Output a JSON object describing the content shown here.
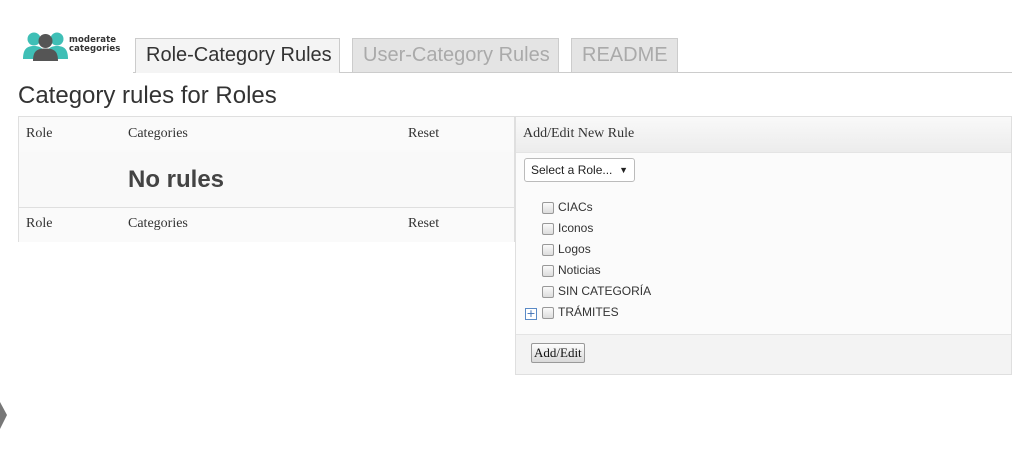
{
  "logo": {
    "line1": "moderate",
    "line2": "categories"
  },
  "tabs": [
    {
      "label": "Role-Category Rules",
      "active": true
    },
    {
      "label": "User-Category Rules",
      "active": false
    },
    {
      "label": "README",
      "active": false
    }
  ],
  "page_title": "Category rules for Roles",
  "rules_table": {
    "columns": [
      "Role",
      "Categories",
      "Reset"
    ],
    "empty_message": "No rules",
    "footer_columns": [
      "Role",
      "Categories",
      "Reset"
    ]
  },
  "add_edit_panel": {
    "title": "Add/Edit New Rule",
    "role_select": {
      "selected": "Select a Role...",
      "arrow": "▼"
    },
    "categories": [
      {
        "label": "CIACs",
        "checked": false
      },
      {
        "label": "Iconos",
        "checked": false
      },
      {
        "label": "Logos",
        "checked": false
      },
      {
        "label": "Noticias",
        "checked": false
      },
      {
        "label": "SIN CATEGORÍA",
        "checked": false
      },
      {
        "label": "TRÁMITES",
        "checked": false,
        "expandable": true
      }
    ],
    "expander_symbol": "+",
    "submit_label": "Add/Edit"
  },
  "colors": {
    "logo_accent": "#3fbfb6",
    "logo_dark": "#555555",
    "expander_blue": "#3b6db3"
  },
  "icons": {
    "logo": "people-group-icon",
    "edge": "chevron-right-icon"
  }
}
